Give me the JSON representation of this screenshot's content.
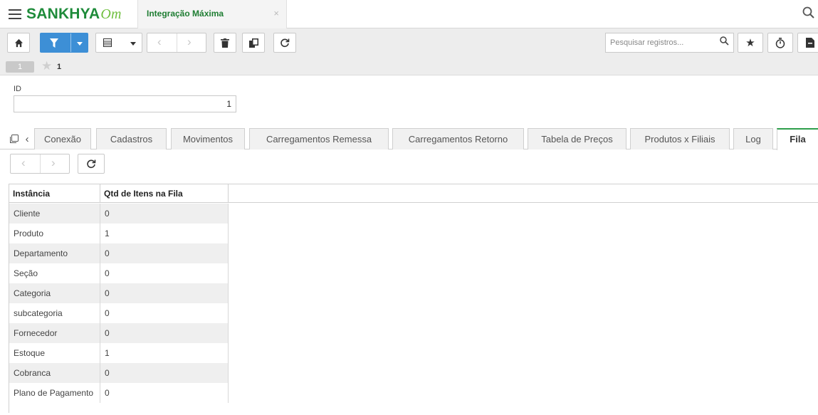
{
  "header": {
    "logo_main": "SANKHYA",
    "logo_suffix": "Om",
    "app_tab_title": "Integração Máxima",
    "app_tab_close": "×"
  },
  "toolbar": {
    "search_placeholder": "Pesquisar registros...",
    "record_badge": "1",
    "favorite_count": "1"
  },
  "form": {
    "id_label": "ID",
    "id_value": "1"
  },
  "tabs": [
    {
      "label": "Conexão",
      "active": false
    },
    {
      "label": "Cadastros",
      "active": false
    },
    {
      "label": "Movimentos",
      "active": false
    },
    {
      "label": "Carregamentos Remessa",
      "active": false
    },
    {
      "label": "Carregamentos Retorno",
      "active": false
    },
    {
      "label": "Tabela de Preços",
      "active": false
    },
    {
      "label": "Produtos x Filiais",
      "active": false
    },
    {
      "label": "Log",
      "active": false
    },
    {
      "label": "Fila",
      "active": true
    }
  ],
  "grid": {
    "columns": [
      "Instância",
      "Qtd de Itens na Fila"
    ],
    "rows": [
      [
        "Cliente",
        "0"
      ],
      [
        "Produto",
        "1"
      ],
      [
        "Departamento",
        "0"
      ],
      [
        "Seção",
        "0"
      ],
      [
        "Categoria",
        "0"
      ],
      [
        "subcategoria",
        "0"
      ],
      [
        "Fornecedor",
        "0"
      ],
      [
        "Estoque",
        "1"
      ],
      [
        "Cobranca",
        "0"
      ],
      [
        "Plano de Pagamento",
        "0"
      ]
    ]
  },
  "colors": {
    "brand_green": "#1e8b3a",
    "primary_blue": "#3d8fd6",
    "active_tab_border": "#2e9e4b"
  }
}
